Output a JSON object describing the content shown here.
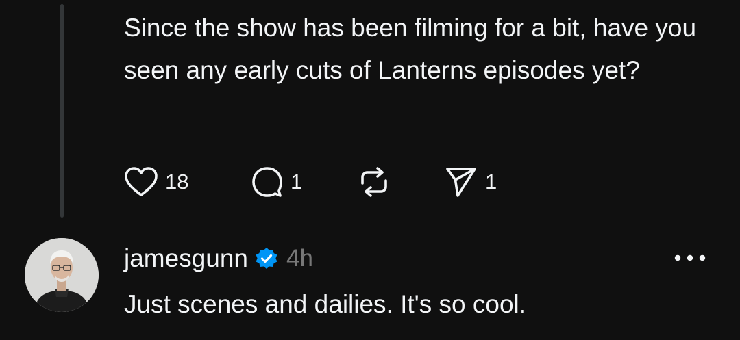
{
  "parent_post": {
    "text": "Since the show has been filming for a bit, have you seen any early cuts of Lanterns episodes yet?",
    "actions": {
      "like": {
        "icon": "heart-icon",
        "count": "18"
      },
      "reply": {
        "icon": "comment-icon",
        "count": "1"
      },
      "repost": {
        "icon": "repost-icon",
        "count": ""
      },
      "share": {
        "icon": "send-icon",
        "count": "1"
      }
    }
  },
  "reply": {
    "username": "jamesgunn",
    "verified": true,
    "verified_color": "#0095f6",
    "timestamp": "4h",
    "text": "Just scenes and dailies. It's so cool.",
    "more_icon": "more-horizontal-icon"
  },
  "colors": {
    "background": "#101010",
    "text": "#f3f5f7",
    "muted": "#777777",
    "thread_line": "#333638"
  }
}
